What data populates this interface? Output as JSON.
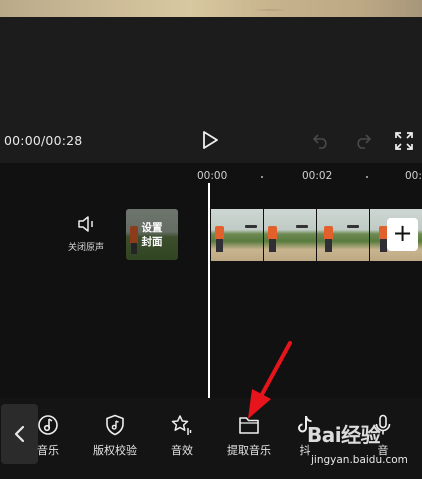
{
  "player": {
    "time": "00:00/00:28"
  },
  "timeline": {
    "ruler": [
      "00:00",
      "00:02",
      "00:0"
    ],
    "mute_label": "关闭原声",
    "cover_label_line1": "设置",
    "cover_label_line2": "封面",
    "add_clip": "+"
  },
  "toolbar": {
    "items": [
      {
        "label": "音乐",
        "icon": "music-note-icon"
      },
      {
        "label": "版权校验",
        "icon": "shield-music-icon"
      },
      {
        "label": "音效",
        "icon": "star-sound-icon"
      },
      {
        "label": "提取音乐",
        "icon": "folder-icon"
      },
      {
        "label": "抖",
        "icon": "tiktok-icon"
      },
      {
        "label": "音",
        "icon": "microphone-icon"
      }
    ]
  },
  "watermark": {
    "logo": "Bai经验",
    "url": "jingyan.baidu.com"
  },
  "colors": {
    "background": "#111111",
    "arrow": "#e8141c",
    "person_shirt": "#e2602c"
  }
}
